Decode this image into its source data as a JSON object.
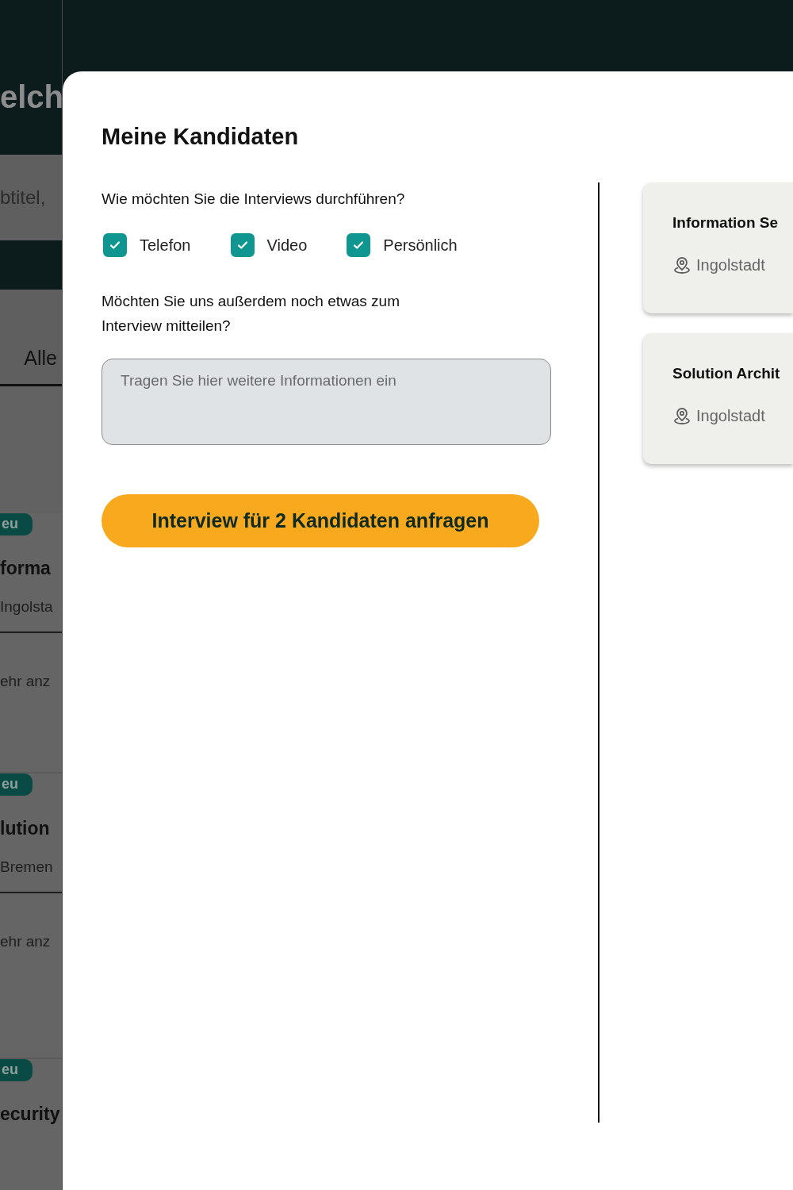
{
  "background": {
    "heading": "elch",
    "search_placeholder": "btitel,",
    "tab": "Alle",
    "jobs": [
      {
        "badge": "eu",
        "title": "forma",
        "location": "Ingolsta",
        "more": "ehr anz"
      },
      {
        "badge": "eu",
        "title": "lution",
        "location": "Bremen",
        "more": "ehr anz"
      },
      {
        "badge": "eu",
        "title": "ecurity"
      }
    ]
  },
  "modal": {
    "title": "Meine Kandidaten",
    "question": "Wie möchten Sie die Interviews durchführen?",
    "options": [
      {
        "label": "Telefon",
        "checked": true
      },
      {
        "label": "Video",
        "checked": true
      },
      {
        "label": "Persönlich",
        "checked": true
      }
    ],
    "message_label": "Möchten Sie uns außerdem noch etwas zum Interview mitteilen?",
    "message": {
      "placeholder": "Tragen Sie hier weitere Informationen ein"
    },
    "submit_button": "Interview für 2 Kandidaten anfragen",
    "candidates": [
      {
        "title": "Information Se",
        "location": "Ingolstadt"
      },
      {
        "title": "Solution Archit",
        "location": "Ingolstadt"
      }
    ]
  }
}
